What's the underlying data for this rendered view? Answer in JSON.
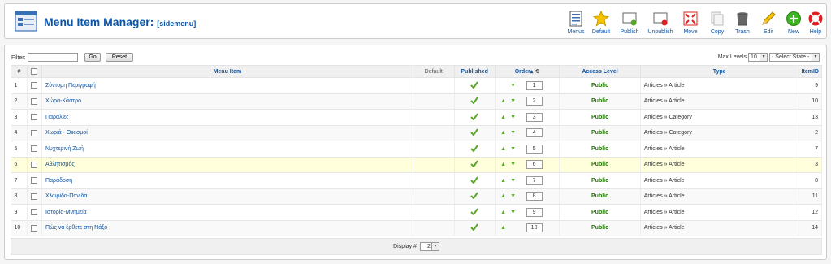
{
  "header": {
    "title": "Menu Item Manager:",
    "subtitle": "[sidemenu]"
  },
  "toolbar": {
    "buttons": [
      {
        "label": "Menus",
        "icon": "menus-icon"
      },
      {
        "label": "Default",
        "icon": "default-star-icon"
      },
      {
        "label": "Publish",
        "icon": "publish-icon"
      },
      {
        "label": "Unpublish",
        "icon": "unpublish-icon"
      },
      {
        "label": "Move",
        "icon": "move-icon"
      },
      {
        "label": "Copy",
        "icon": "copy-icon"
      },
      {
        "label": "Trash",
        "icon": "trash-icon"
      },
      {
        "label": "Edit",
        "icon": "edit-icon"
      },
      {
        "label": "New",
        "icon": "new-icon"
      },
      {
        "label": "Help",
        "icon": "help-icon"
      }
    ]
  },
  "filter": {
    "label": "Filter:",
    "value": "",
    "go_label": "Go",
    "reset_label": "Reset",
    "max_levels_label": "Max Levels",
    "max_levels_value": "10",
    "state_value": "- Select State -"
  },
  "table": {
    "columns": {
      "num": "#",
      "menu_item": "Menu Item",
      "default": "Default",
      "published": "Published",
      "order": "Order",
      "access": "Access Level",
      "type": "Type",
      "itemid": "ItemID"
    },
    "rows": [
      {
        "num": "1",
        "name": "Σύντομη Περιγραφή",
        "order": "1",
        "access": "Public",
        "type": "Articles » Article",
        "itemid": "9"
      },
      {
        "num": "2",
        "name": "Χώρα-Κάστρο",
        "order": "2",
        "access": "Public",
        "type": "Articles » Article",
        "itemid": "10"
      },
      {
        "num": "3",
        "name": "Παραλίες",
        "order": "3",
        "access": "Public",
        "type": "Articles » Category",
        "itemid": "13"
      },
      {
        "num": "4",
        "name": "Χωριά - Οικισμοί",
        "order": "4",
        "access": "Public",
        "type": "Articles » Category",
        "itemid": "2"
      },
      {
        "num": "5",
        "name": "Νυχτερινή Ζωή",
        "order": "5",
        "access": "Public",
        "type": "Articles » Article",
        "itemid": "7"
      },
      {
        "num": "6",
        "name": "Αθλητισμός",
        "order": "6",
        "access": "Public",
        "type": "Articles » Article",
        "itemid": "3"
      },
      {
        "num": "7",
        "name": "Παράδοση",
        "order": "7",
        "access": "Public",
        "type": "Articles » Article",
        "itemid": "8"
      },
      {
        "num": "8",
        "name": "Χλωρίδα-Πανίδα",
        "order": "8",
        "access": "Public",
        "type": "Articles » Article",
        "itemid": "11"
      },
      {
        "num": "9",
        "name": "Ιστορία-Μνημεία",
        "order": "9",
        "access": "Public",
        "type": "Articles » Article",
        "itemid": "12"
      },
      {
        "num": "10",
        "name": "Πώς να έρθετε στη Νάξο",
        "order": "10",
        "access": "Public",
        "type": "Articles » Article",
        "itemid": "14"
      }
    ]
  },
  "footer": {
    "display_label": "Display #",
    "display_value": "20"
  },
  "colors": {
    "link": "#0b55a6",
    "access": "#1f7a00",
    "check": "#5aa62b",
    "highlight_row": "#ffffdc"
  }
}
